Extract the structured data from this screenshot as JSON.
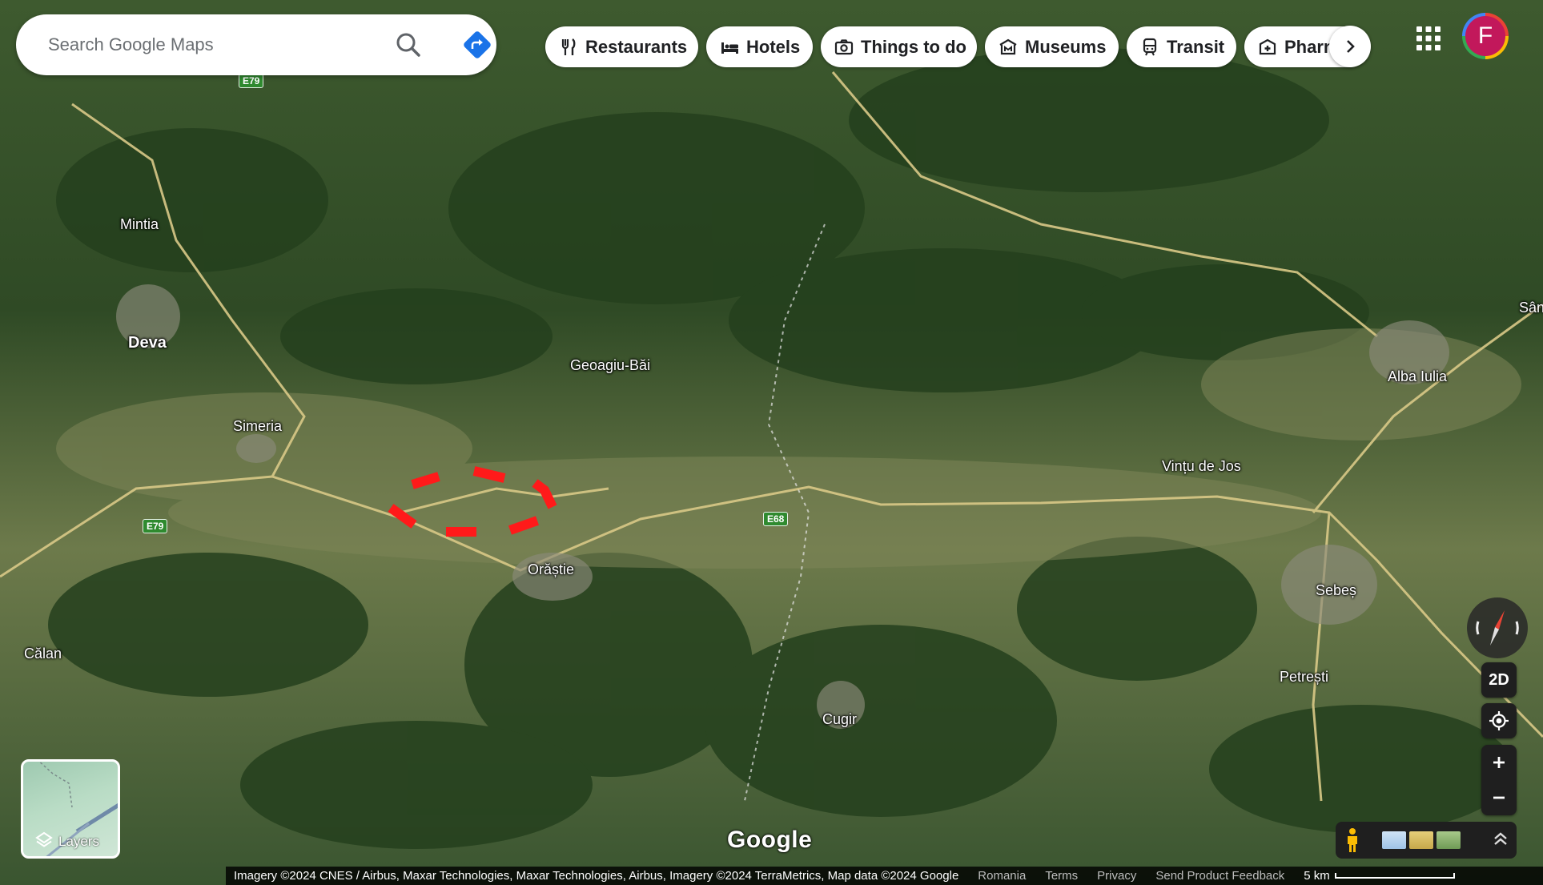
{
  "search": {
    "placeholder": "Search Google Maps"
  },
  "chips": [
    {
      "label": "Restaurants",
      "icon": "fork-knife-icon"
    },
    {
      "label": "Hotels",
      "icon": "bed-icon"
    },
    {
      "label": "Things to do",
      "icon": "camera-icon"
    },
    {
      "label": "Museums",
      "icon": "museum-icon"
    },
    {
      "label": "Transit",
      "icon": "train-icon"
    },
    {
      "label": "Pharn",
      "icon": "pharmacy-icon"
    }
  ],
  "account": {
    "initial": "F"
  },
  "places": {
    "mintia": "Mintia",
    "deva": "Deva",
    "simeria": "Simeria",
    "geoagiu_bai": "Geoagiu-Băi",
    "orastie": "Orăștie",
    "calan": "Călan",
    "cugir": "Cugir",
    "vintu_de_jos": "Vințu de Jos",
    "alba_iulia": "Alba Iulia",
    "sebes": "Sebeș",
    "petresti": "Petrești",
    "san": "Sân"
  },
  "road_labels": {
    "e79_top": "E79",
    "e79_left": "E79",
    "e68": "E68"
  },
  "controls": {
    "view_mode": "2D"
  },
  "layers": {
    "label": "Layers"
  },
  "brand": {
    "logo_text": "Google"
  },
  "footer": {
    "attribution": "Imagery ©2024 CNES / Airbus, Maxar Technologies, Maxar Technologies, Airbus, Imagery ©2024 TerraMetrics, Map data ©2024 Google",
    "country": "Romania",
    "terms": "Terms",
    "privacy": "Privacy",
    "feedback": "Send Product Feedback",
    "scale": "5 km"
  },
  "colors": {
    "annotation": "#ff1a1a",
    "directions": "#1a73e8",
    "avatar": "#c2185b"
  }
}
